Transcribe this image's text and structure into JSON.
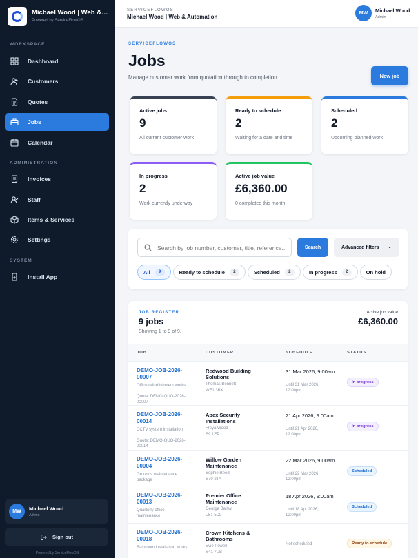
{
  "brand": {
    "title": "Michael Wood | Web & A...",
    "subtitle": "Powered by ServiceFlowOS"
  },
  "sidebar": {
    "sections": {
      "workspace": "WORKSPACE",
      "administration": "ADMINISTRATION",
      "system": "SYSTEM"
    },
    "items": [
      {
        "label": "Dashboard",
        "icon": "dashboard-icon"
      },
      {
        "label": "Customers",
        "icon": "users-icon"
      },
      {
        "label": "Quotes",
        "icon": "document-icon"
      },
      {
        "label": "Jobs",
        "icon": "briefcase-icon",
        "active": true
      },
      {
        "label": "Calendar",
        "icon": "calendar-icon"
      },
      {
        "label": "Invoices",
        "icon": "receipt-icon"
      },
      {
        "label": "Staff",
        "icon": "staff-icon"
      },
      {
        "label": "Items & Services",
        "icon": "box-icon"
      },
      {
        "label": "Settings",
        "icon": "gear-icon"
      },
      {
        "label": "Install App",
        "icon": "phone-icon"
      }
    ],
    "user": {
      "initials": "MW",
      "name": "Michael Wood",
      "role": "Admin"
    },
    "signout": "Sign out",
    "footer": "Powered by ServiceFlowOS"
  },
  "topbar": {
    "eyebrow": "SERVICEFLOWOS",
    "title": "Michael Wood | Web & Automation",
    "initials": "MW",
    "name": "Michael Wood",
    "role": "Admin"
  },
  "header": {
    "eyebrow": "SERVICEFLOWOS",
    "title": "Jobs",
    "subtitle": "Manage customer work from quotation through to completion.",
    "new_job": "New job"
  },
  "stats": [
    {
      "label": "Active jobs",
      "value": "9",
      "sub": "All current customer work",
      "color": "#374151"
    },
    {
      "label": "Ready to schedule",
      "value": "2",
      "sub": "Waiting for a date and time",
      "color": "#f59e0b"
    },
    {
      "label": "Scheduled",
      "value": "2",
      "sub": "Upcoming planned work",
      "color": "#2b7bde"
    },
    {
      "label": "In progress",
      "value": "2",
      "sub": "Work currently underway",
      "color": "#8b5cf6"
    },
    {
      "label": "Active job value",
      "value": "£6,360.00",
      "sub": "0 completed this month",
      "color": "#22c55e"
    }
  ],
  "search": {
    "placeholder": "Search by job number, customer, title, reference...",
    "button": "Search",
    "advanced": "Advanced filters",
    "chevron": "⌄"
  },
  "chips": [
    {
      "label": "All",
      "count": "9",
      "active": true
    },
    {
      "label": "Ready to schedule",
      "count": "2"
    },
    {
      "label": "Scheduled",
      "count": "2"
    },
    {
      "label": "In progress",
      "count": "2"
    },
    {
      "label": "On hold",
      "count": ""
    }
  ],
  "register": {
    "eyebrow": "JOB REGISTER",
    "title": "9 jobs",
    "subtitle": "Showing 1 to 9 of 9.",
    "value_label": "Active job value",
    "value": "£6,360.00",
    "columns": [
      "JOB",
      "CUSTOMER",
      "SCHEDULE",
      "STATUS"
    ],
    "rows": [
      {
        "id": "DEMO-JOB-2026-00007",
        "desc": "Office refurbishment works",
        "quote": "Quote: DEMO-QUO-2026-00007",
        "customer": "Redwood Building Solutions",
        "contact": "Thomas Bennett",
        "postcode": "WF1 3BX",
        "schedule": "31 Mar 2026, 9:00am",
        "until": "Until 31 Mar 2026, 12:00pm",
        "status": "In progress",
        "kind": "progress"
      },
      {
        "id": "DEMO-JOB-2026-00014",
        "desc": "CCTV system installation",
        "quote": "Quote: DEMO-QUO-2026-00014",
        "customer": "Apex Security Installations",
        "contact": "Freya Wood",
        "postcode": "S9 1EP",
        "schedule": "21 Apr 2026, 9:00am",
        "until": "Until 21 Apr 2026, 12:00pm",
        "status": "In progress",
        "kind": "progress"
      },
      {
        "id": "DEMO-JOB-2026-00004",
        "desc": "Grounds maintenance package",
        "quote": "",
        "customer": "Willow Garden Maintenance",
        "contact": "Sophie Reed",
        "postcode": "S70 2TA",
        "schedule": "22 Mar 2026, 9:00am",
        "until": "Until 22 Mar 2026, 12:00pm",
        "status": "Scheduled",
        "kind": "scheduled"
      },
      {
        "id": "DEMO-JOB-2026-00013",
        "desc": "Quarterly office maintenance",
        "quote": "",
        "customer": "Premier Office Maintenance",
        "contact": "George Bailey",
        "postcode": "LS1 5DL",
        "schedule": "18 Apr 2026, 9:00am",
        "until": "Until 18 Apr 2026, 12:00pm",
        "status": "Scheduled",
        "kind": "scheduled"
      },
      {
        "id": "DEMO-JOB-2026-00018",
        "desc": "Bathroom installation works",
        "quote": "",
        "customer": "Crown Kitchens & Bathrooms",
        "contact": "Evie Powell",
        "postcode": "S41 7UB",
        "schedule": "Not scheduled",
        "until": "",
        "status": "Ready to schedule",
        "kind": "ready"
      }
    ]
  }
}
